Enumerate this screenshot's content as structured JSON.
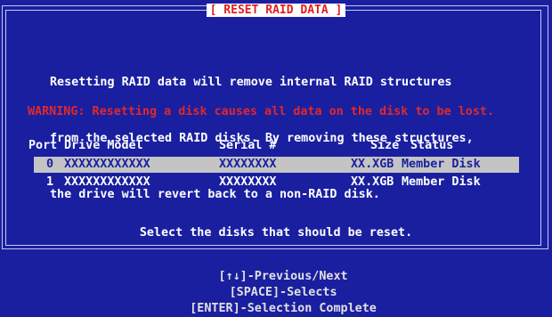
{
  "dialog": {
    "title": "[ RESET RAID DATA ]",
    "description": [
      "Resetting RAID data will remove internal RAID structures",
      "from the selected RAID disks. By removing these structures,",
      "the drive will revert back to a non-RAID disk."
    ],
    "warning": "WARNING: Resetting a disk causes all data on the disk to be lost."
  },
  "table": {
    "headers": {
      "port": "Port",
      "model": "Drive Model",
      "serial": "Serial #",
      "size": "Size",
      "status": "Status"
    },
    "rows": [
      {
        "port": "0",
        "model": "XXXXXXXXXXXX",
        "serial": "XXXXXXXX",
        "size": "XX.XGB",
        "status": "Member Disk"
      },
      {
        "port": "1",
        "model": "XXXXXXXXXXXX",
        "serial": "XXXXXXXX",
        "size": "XX.XGB",
        "status": "Member Disk"
      }
    ]
  },
  "prompt": "Select the disks that should be reset.",
  "footer": {
    "nav": "[↑↓]-Previous/Next",
    "select": "[SPACE]-Selects",
    "complete": "[ENTER]-Selection Complete"
  },
  "colors": {
    "background": "#1a1fa0",
    "warning": "#e02828",
    "highlight": "#c4c4c4"
  }
}
